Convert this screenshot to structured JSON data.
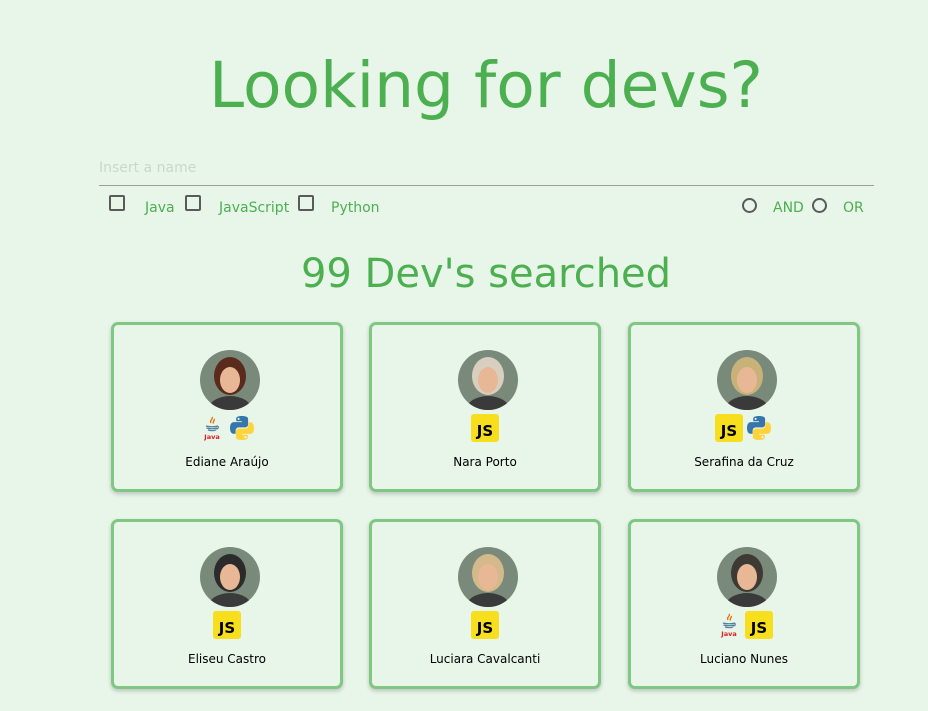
{
  "header": {
    "title": "Looking for devs?"
  },
  "search": {
    "placeholder": "Insert a name",
    "value": ""
  },
  "filters": {
    "languages": [
      {
        "label": "Java",
        "checked": false
      },
      {
        "label": "JavaScript",
        "checked": false
      },
      {
        "label": "Python",
        "checked": false
      }
    ],
    "modes": [
      {
        "label": "AND",
        "selected": false
      },
      {
        "label": "OR",
        "selected": false
      }
    ]
  },
  "results": {
    "count_text": "99 Dev's searched"
  },
  "devs": [
    {
      "name": "Ediane Araújo",
      "langs": [
        "java",
        "python"
      ],
      "avatar_color": "#5a2a1c"
    },
    {
      "name": "Nara Porto",
      "langs": [
        "javascript"
      ],
      "avatar_color": "#d9cfc0"
    },
    {
      "name": "Serafina da Cruz",
      "langs": [
        "javascript",
        "python"
      ],
      "avatar_color": "#c9b27a"
    },
    {
      "name": "Eliseu Castro",
      "langs": [
        "javascript"
      ],
      "avatar_color": "#2b2b2b"
    },
    {
      "name": "Luciara Cavalcanti",
      "langs": [
        "javascript"
      ],
      "avatar_color": "#d4b98a"
    },
    {
      "name": "Luciano Nunes",
      "langs": [
        "java",
        "javascript"
      ],
      "avatar_color": "#3d3a33"
    }
  ],
  "icons": {
    "java": "java-icon",
    "javascript": "javascript-icon",
    "python": "python-icon"
  },
  "colors": {
    "accent": "#4caf50",
    "card_border": "#81c784",
    "background": "#e8f5e9",
    "js_yellow": "#f7df1e"
  }
}
